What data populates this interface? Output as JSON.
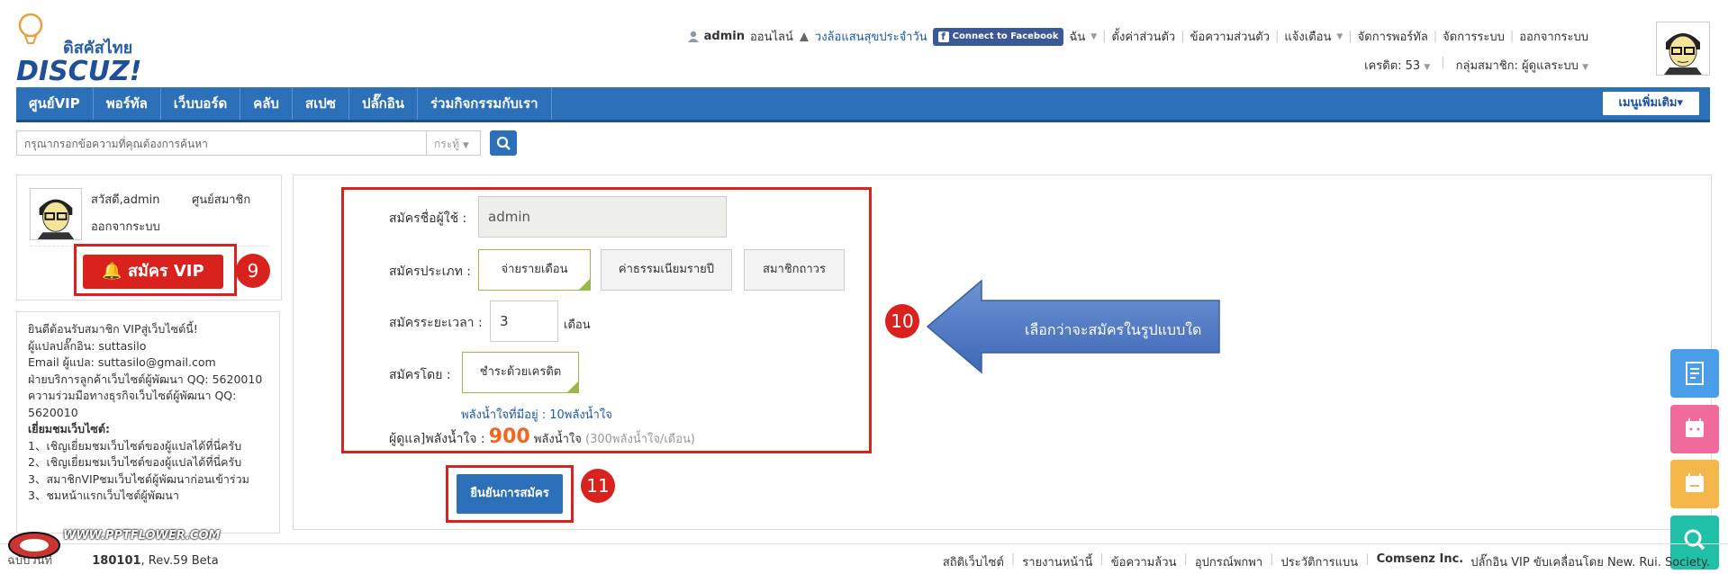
{
  "logo": {
    "thai": "ดิสคัสไทย",
    "main": "DISCUZ!"
  },
  "userbar": {
    "username": "admin",
    "status": "ออนไลน์",
    "daily_link": "วงล้อแสนสุขประจำวัน",
    "facebook_button": "Connect to Facebook",
    "items": [
      "ฉัน",
      "ตั้งค่าส่วนตัว",
      "ข้อความส่วนตัว",
      "แจ้งเตือน",
      "จัดการพอร์ทัล",
      "จัดการระบบ",
      "ออกจากระบบ"
    ],
    "credits": "เครดิต: 53",
    "group": "กลุ่มสมาชิก: ผู้ดูแลระบบ"
  },
  "nav": {
    "items": [
      "ศูนย์VIP",
      "พอร์ทัล",
      "เว็บบอร์ด",
      "คลับ",
      "สเปซ",
      "ปลั๊กอิน",
      "ร่วมกิจกรรมกับเรา"
    ],
    "more": "เมนูเพิ่มเติม"
  },
  "search": {
    "placeholder": "กรุณากรอกข้อความที่คุณต้องการค้นหา",
    "type": "กระทู้"
  },
  "left": {
    "hello": "สวัสดี,admin",
    "member_center": "ศูนย์สมาชิก",
    "logout": "ออกจากระบบ",
    "vip_button": "สมัคร VIP",
    "info_lines": [
      "ยินดีต้อนรับสมาชิก VIPสู่เว็บไซต์นี้!",
      "ผู้แปลปลั๊กอิน: suttasilo",
      "Email ผู้แปล: suttasilo@gmail.com",
      "ฝ่ายบริการลูกค้าเว็บไซต์ผู้พัฒนา QQ: 5620010",
      "ความร่วมมือทางธุรกิจเว็บไซต์ผู้พัฒนา QQ:",
      "5620010"
    ],
    "visit_title": "เยี่ยมชมเว็บไซต์:",
    "visit_lines": [
      "1、เชิญเยี่ยมชมเว็บไซต์ของผู้แปลได้ที่นี่ครับ",
      "2、เชิญเยี่ยมชมเว็บไซต์ของผู้แปลได้ที่นี่ครับ",
      "3、สมาชิกVIPชมเว็บไซต์ผู้พัฒนาก่อนเข้าร่วม",
      "3、ชมหน้าแรกเว็บไซต์ผู้พัฒนา"
    ]
  },
  "form": {
    "username_label": "สมัครชื่อผู้ใช้ :",
    "username_value": "admin",
    "type_label": "สมัครประเภท :",
    "type_options": [
      "จ่ายรายเดือน",
      "ค่าธรรมเนียมรายปี",
      "สมาชิกถาวร"
    ],
    "duration_label": "สมัครระยะเวลา :",
    "duration_value": "3",
    "duration_unit": "เดือน",
    "pay_label": "สมัครโดย :",
    "pay_option": "ชำระด้วยเครดิต",
    "balance": "พลังน้ำใจที่มีอยู่ : 10พลังน้ำใจ",
    "cost_label": "ผู้ดูแล]พลังน้ำใจ :",
    "cost_value": "900",
    "cost_unit": "พลังน้ำใจ",
    "cost_note": "(300พลังน้ำใจ/เดือน)",
    "confirm": "ยืนยันการสมัคร"
  },
  "annotations": {
    "badge_9": "9",
    "badge_10": "10",
    "badge_11": "11",
    "arrow_text": "เลือกว่าจะสมัครในรูปแบบใด"
  },
  "footer": {
    "left_prefix": "ฉบับวันที่",
    "left_code": "180101",
    "left_rev": ", Rev.59 Beta",
    "right_items": [
      "สถิติเว็บไซต์",
      "รายงานหน้านี้",
      "ข้อความล้วน",
      "อุปกรณ์พกพา",
      "ประวัติการแบน"
    ],
    "company": "Comsenz Inc.",
    "powered": "ปลั๊กอิน VIP ขับเคลื่อนโดย New. Rui. Society."
  },
  "watermark": {
    "text": "WWW.PPTFLOWER.COM"
  },
  "colors": {
    "nav": "#2b70b8",
    "highlight": "#d9211e",
    "accent_orange": "#f26522",
    "select_green": "#9bb84a"
  },
  "float_buttons": [
    {
      "icon": "document-icon",
      "color": "#4a9de8"
    },
    {
      "icon": "calendar-icon",
      "color": "#f06b9c"
    },
    {
      "icon": "calendar-icon",
      "color": "#f5b64a"
    },
    {
      "icon": "search-icon",
      "color": "#1fbfa8"
    }
  ]
}
